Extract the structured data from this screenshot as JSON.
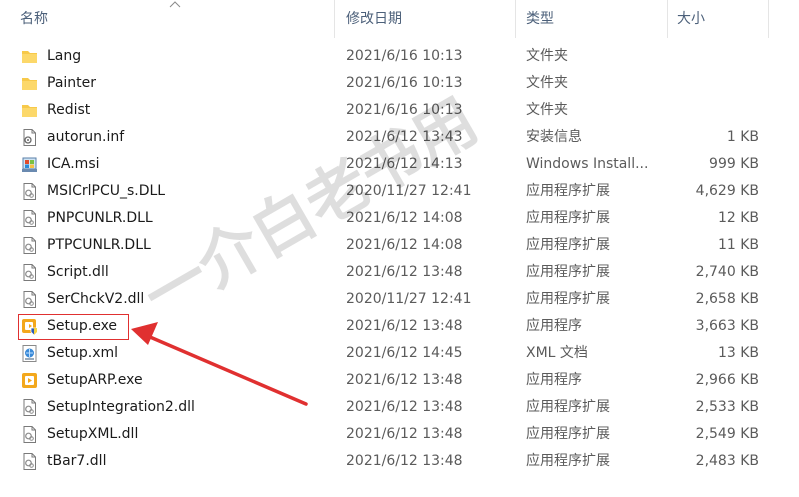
{
  "columns": {
    "name": "名称",
    "modified": "修改日期",
    "type": "类型",
    "size": "大小"
  },
  "files": [
    {
      "name": "Lang",
      "date": "2021/6/16 10:13",
      "type": "文件夹",
      "size": "",
      "icon": "folder-icon"
    },
    {
      "name": "Painter",
      "date": "2021/6/16 10:13",
      "type": "文件夹",
      "size": "",
      "icon": "folder-icon"
    },
    {
      "name": "Redist",
      "date": "2021/6/16 10:13",
      "type": "文件夹",
      "size": "",
      "icon": "folder-icon"
    },
    {
      "name": "autorun.inf",
      "date": "2021/6/12 13:43",
      "type": "安装信息",
      "size": "1 KB",
      "icon": "inf-file-icon"
    },
    {
      "name": "ICA.msi",
      "date": "2021/6/12 14:13",
      "type": "Windows Install...",
      "size": "999 KB",
      "icon": "msi-file-icon"
    },
    {
      "name": "MSICrlPCU_s.DLL",
      "date": "2020/11/27 12:41",
      "type": "应用程序扩展",
      "size": "4,629 KB",
      "icon": "dll-file-icon"
    },
    {
      "name": "PNPCUNLR.DLL",
      "date": "2021/6/12 14:08",
      "type": "应用程序扩展",
      "size": "12 KB",
      "icon": "dll-file-icon"
    },
    {
      "name": "PTPCUNLR.DLL",
      "date": "2021/6/12 14:08",
      "type": "应用程序扩展",
      "size": "11 KB",
      "icon": "dll-file-icon"
    },
    {
      "name": "Script.dll",
      "date": "2021/6/12 13:48",
      "type": "应用程序扩展",
      "size": "2,740 KB",
      "icon": "dll-file-icon"
    },
    {
      "name": "SerChckV2.dll",
      "date": "2020/11/27 12:41",
      "type": "应用程序扩展",
      "size": "2,658 KB",
      "icon": "dll-file-icon"
    },
    {
      "name": "Setup.exe",
      "date": "2021/6/12 13:48",
      "type": "应用程序",
      "size": "3,663 KB",
      "icon": "setup-exe-icon"
    },
    {
      "name": "Setup.xml",
      "date": "2021/6/12 14:45",
      "type": "XML 文档",
      "size": "13 KB",
      "icon": "xml-file-icon"
    },
    {
      "name": "SetupARP.exe",
      "date": "2021/6/12 13:48",
      "type": "应用程序",
      "size": "2,966 KB",
      "icon": "app-exe-icon"
    },
    {
      "name": "SetupIntegration2.dll",
      "date": "2021/6/12 13:48",
      "type": "应用程序扩展",
      "size": "2,533 KB",
      "icon": "dll-file-icon"
    },
    {
      "name": "SetupXML.dll",
      "date": "2021/6/12 13:48",
      "type": "应用程序扩展",
      "size": "2,549 KB",
      "icon": "dll-file-icon"
    },
    {
      "name": "tBar7.dll",
      "date": "2021/6/12 13:48",
      "type": "应用程序扩展",
      "size": "2,483 KB",
      "icon": "dll-file-icon"
    }
  ],
  "watermark": "一介白老书用",
  "colors": {
    "annotation": "#e03030",
    "folder": "#f7c94a",
    "header_text": "#4c607a"
  }
}
